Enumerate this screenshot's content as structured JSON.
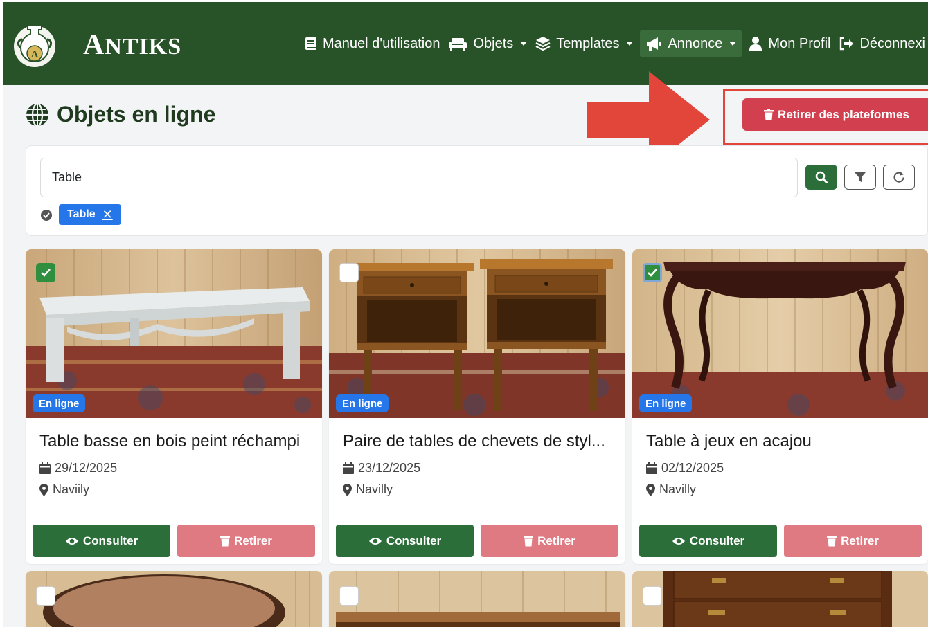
{
  "brand": {
    "name_first": "A",
    "name_rest": "NTIKS",
    "logo_letter": "A"
  },
  "nav": {
    "items": [
      {
        "label": "Manuel d'utilisation",
        "icon": "book-icon",
        "dropdown": false,
        "active": false
      },
      {
        "label": "Objets",
        "icon": "couch-icon",
        "dropdown": true,
        "active": false
      },
      {
        "label": "Templates",
        "icon": "layers-icon",
        "dropdown": true,
        "active": false
      },
      {
        "label": "Annonce",
        "icon": "megaphone-icon",
        "dropdown": true,
        "active": true
      },
      {
        "label": "Mon Profil",
        "icon": "user-icon",
        "dropdown": false,
        "active": false
      },
      {
        "label": "Déconnexi",
        "icon": "logout-icon",
        "dropdown": false,
        "active": false
      }
    ]
  },
  "page": {
    "title": "Objets en ligne",
    "title_icon": "globe-icon",
    "remove_platforms_label": "Retirer des plateformes"
  },
  "search": {
    "value": "Table",
    "chip_label": "Table",
    "chip_remove": "✕"
  },
  "cards": [
    {
      "title": "Table basse en bois peint réchampi",
      "date": "29/12/2025",
      "location": "Naviily",
      "status": "En ligne",
      "checked": true,
      "consult_label": "Consulter",
      "remove_label": "Retirer"
    },
    {
      "title": "Paire de tables de chevets de styl...",
      "date": "23/12/2025",
      "location": "Navilly",
      "status": "En ligne",
      "checked": false,
      "consult_label": "Consulter",
      "remove_label": "Retirer"
    },
    {
      "title": "Table à jeux en acajou",
      "date": "02/12/2025",
      "location": "Navilly",
      "status": "En ligne",
      "checked": true,
      "consult_label": "Consulter",
      "remove_label": "Retirer"
    }
  ],
  "colors": {
    "navbar": "#285328",
    "primary_green": "#2c6e3a",
    "danger": "#d2404f",
    "danger_light": "#e07a82",
    "badge_blue": "#2576e8",
    "arrow_red": "#e2453a"
  }
}
